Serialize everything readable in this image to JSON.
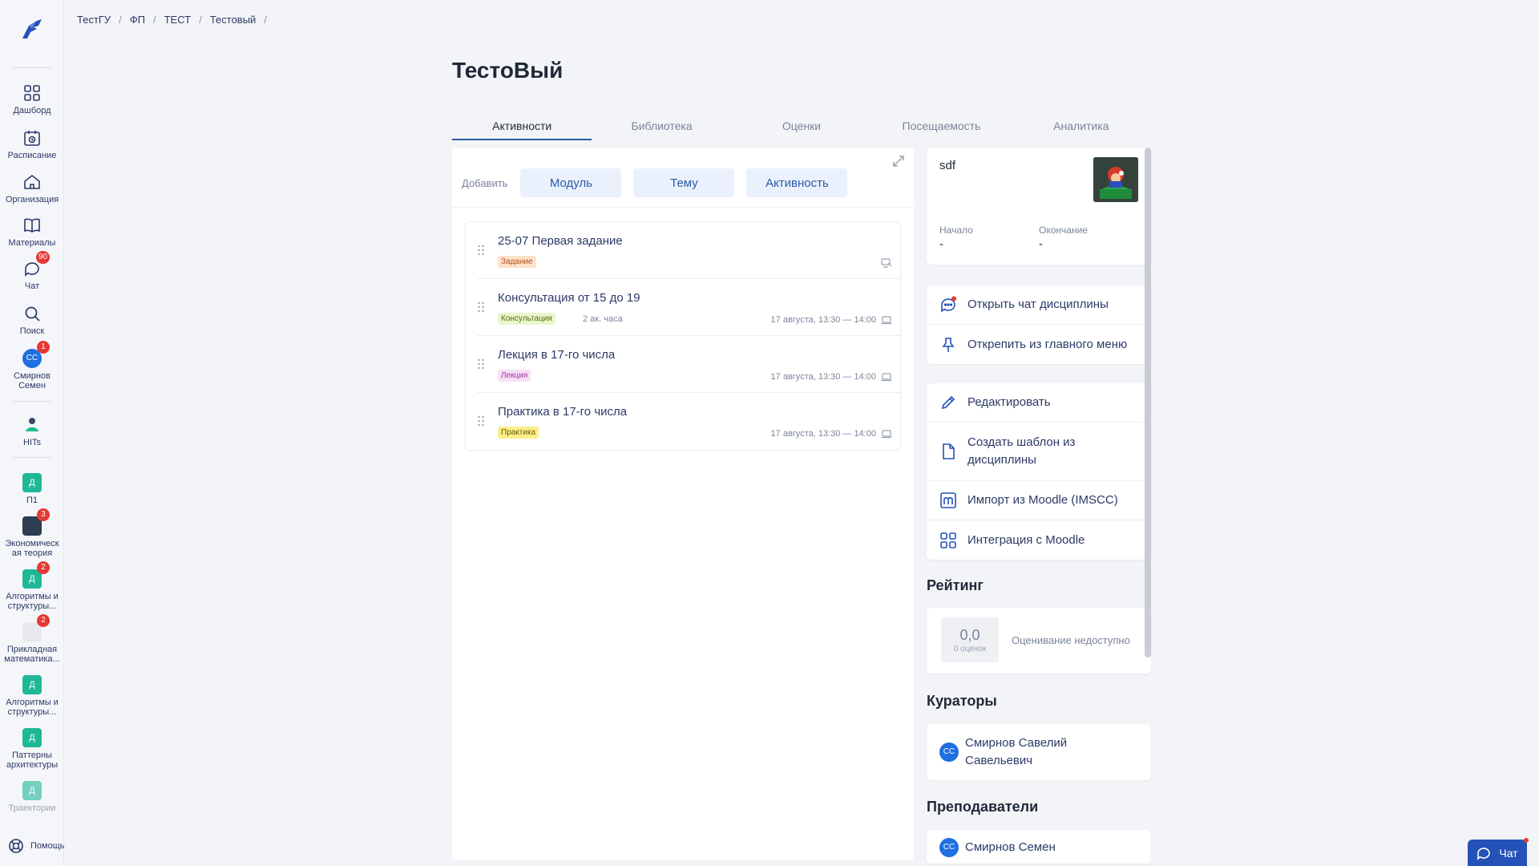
{
  "breadcrumb": [
    "ТестГУ",
    "ФП",
    "ТЕСТ",
    "Тестовый"
  ],
  "breadcrumb_sep": "/",
  "page_title": "ТестоВый",
  "tabs": [
    "Активности",
    "Библиотека",
    "Оценки",
    "Посещаемость",
    "Аналитика"
  ],
  "active_tab": "Активности",
  "add": {
    "label": "Добавить",
    "buttons": [
      "Модуль",
      "Тему",
      "Активность"
    ]
  },
  "activities": [
    {
      "title": "25-07 Первая задание",
      "tag": "Задание",
      "duration": "",
      "date": ""
    },
    {
      "title": "Консультация от 15 до 19",
      "tag": "Консультация",
      "duration": "2 ак. часа",
      "date": "17 августа, 13:30 — 14:00"
    },
    {
      "title": "Лекция в 17-го числа",
      "tag": "Лекция",
      "duration": "",
      "date": "17 августа, 13:30 — 14:00"
    },
    {
      "title": "Практика в 17-го числа",
      "tag": "Практика",
      "duration": "",
      "date": "17 августа, 13:30 — 14:00"
    }
  ],
  "course_card": {
    "title": "sdf",
    "start_label": "Начало",
    "start_value": "-",
    "end_label": "Окончание",
    "end_value": "-"
  },
  "menu_group1": [
    {
      "label": "Открыть чат дисциплины",
      "icon": "chat-icon"
    },
    {
      "label": "Открепить из главного меню",
      "icon": "pin-icon"
    }
  ],
  "menu_group2": [
    {
      "label": "Редактировать",
      "icon": "pencil-icon"
    },
    {
      "label": "Создать шаблон из дисциплины",
      "icon": "document-icon"
    },
    {
      "label": "Импорт из Moodle (IMSCC)",
      "icon": "moodle-icon"
    },
    {
      "label": "Интеграция с Moodle",
      "icon": "grid-icon"
    }
  ],
  "rating": {
    "heading": "Рейтинг",
    "value": "0,0",
    "count": "0 оценок",
    "note": "Оценивание недоступно"
  },
  "curators": {
    "heading": "Кураторы",
    "people": [
      {
        "initials": "СС",
        "name": "Смирнов Савелий Савельевич"
      }
    ]
  },
  "teachers": {
    "heading": "Преподаватели",
    "people": [
      {
        "initials": "СС",
        "name": "Смирнов Семен"
      }
    ]
  },
  "sidebar": {
    "items": [
      {
        "label": "Дашборд",
        "icon": "dashboard-icon"
      },
      {
        "label": "Расписание",
        "icon": "schedule-icon"
      },
      {
        "label": "Организация",
        "icon": "organization-icon"
      },
      {
        "label": "Материалы",
        "icon": "book-icon"
      },
      {
        "label": "Чат",
        "icon": "chat-icon",
        "badge": "90"
      },
      {
        "label": "Поиск",
        "icon": "search-icon"
      },
      {
        "label": "Смирнов Семен",
        "icon": "avatar",
        "initials": "СС",
        "badge": "1"
      },
      {
        "label": "HITs",
        "icon": "hits-logo-icon"
      }
    ],
    "courses": [
      {
        "label": "П1",
        "initial": "Д",
        "badge": ""
      },
      {
        "label": "Экономическ ая теория",
        "initial": "",
        "badge": "3"
      },
      {
        "label": "Алгоритмы и структуры...",
        "initial": "Д",
        "badge": "2"
      },
      {
        "label": "Прикладная математика...",
        "initial": "",
        "badge": "2"
      },
      {
        "label": "Алгоритмы и структуры...",
        "initial": "Д",
        "badge": ""
      },
      {
        "label": "Паттерны архитектуры",
        "initial": "Д",
        "badge": ""
      },
      {
        "label": "Траектории",
        "initial": "Д",
        "badge": ""
      }
    ],
    "help": "Помощь"
  },
  "chat_fab": "Чат",
  "colors": {
    "accent": "#2b5aa8",
    "badge": "#e53935",
    "course_square": "#1fb896"
  }
}
